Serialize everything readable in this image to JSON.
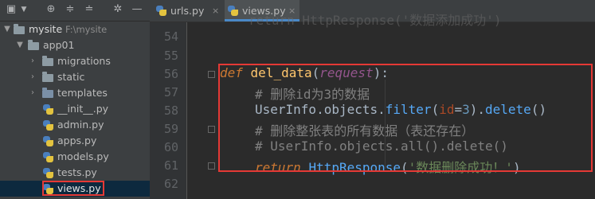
{
  "toolbar": {
    "icons": [
      "project-icon",
      "dropdown-icon",
      "target-icon",
      "collapse-icon",
      "expand-icon",
      "settings-icon",
      "hide-icon"
    ]
  },
  "tree": {
    "root_label": "mysite",
    "root_path": "F:\\mysite",
    "app_label": "app01",
    "folders": [
      "migrations",
      "static",
      "templates"
    ],
    "files": [
      "__init__.py",
      "admin.py",
      "apps.py",
      "models.py",
      "tests.py",
      "views.py"
    ]
  },
  "tabs": [
    {
      "label": "urls.py",
      "close": "×"
    },
    {
      "label": "views.py",
      "close": "×"
    }
  ],
  "editor": {
    "line_numbers": [
      "54",
      "55",
      "56",
      "57",
      "58",
      "59",
      "60",
      "61",
      "62"
    ],
    "partial_line": "return HttpResponse('数据添加成功')",
    "def_kw": "def",
    "fn_name": "del_data",
    "param": "request",
    "comment1": "# 删除id为3的数据",
    "obj": "UserInfo.objects.",
    "filter": "filter",
    "filter_arg_name": "id",
    "filter_arg_val": "3",
    "delete": "delete",
    "comment2": "# 删除整张表的所有数据（表还存在）",
    "comment3": "# UserInfo.objects.all().delete()",
    "return_kw": "return",
    "http_cls": "HttpResponse",
    "return_str": "'数据删除成功！'"
  },
  "colors": {
    "highlight_border": "#e53935",
    "keyword": "#cc7832",
    "function": "#ffc66d",
    "comment": "#808080",
    "string": "#6a8759"
  }
}
